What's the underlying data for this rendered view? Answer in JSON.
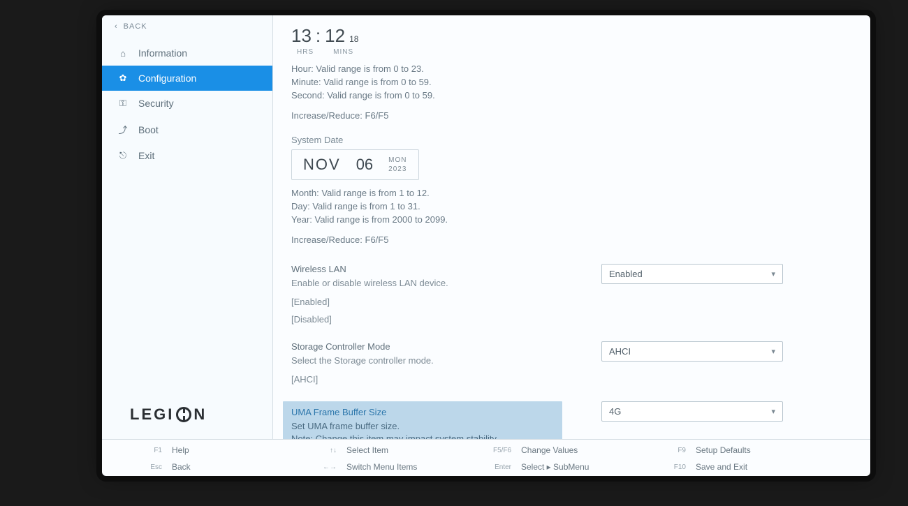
{
  "back_label": "BACK",
  "sidebar": {
    "items": [
      {
        "label": "Information",
        "icon": "⌂"
      },
      {
        "label": "Configuration",
        "icon": "✿"
      },
      {
        "label": "Security",
        "icon": "⚿"
      },
      {
        "label": "Boot",
        "icon": "⤴"
      },
      {
        "label": "Exit",
        "icon": "⎋"
      }
    ],
    "active_index": 1
  },
  "brand": "LEGION",
  "time": {
    "hrs": "13",
    "sep": ":",
    "mins": "12",
    "secs": "18",
    "hrs_label": "HRS",
    "mins_label": "MINS",
    "help": [
      "Hour: Valid range is from 0 to 23.",
      "Minute: Valid range is from 0 to 59.",
      "Second: Valid range is from 0 to 59."
    ],
    "increase_reduce": "Increase/Reduce: F6/F5"
  },
  "date": {
    "section_label": "System Date",
    "month": "NOV",
    "day": "06",
    "dow": "MON",
    "year": "2023",
    "help": [
      "Month: Valid range is from 1 to 12.",
      "Day: Valid range is from 1 to 31.",
      "Year: Valid range is from 2000 to 2099."
    ],
    "increase_reduce": "Increase/Reduce: F6/F5"
  },
  "wireless": {
    "title": "Wireless LAN",
    "desc": "Enable or disable wireless LAN device.",
    "options": [
      "[Enabled]",
      "[Disabled]"
    ],
    "value": "Enabled"
  },
  "storage": {
    "title": "Storage Controller Mode",
    "desc": "Select the Storage controller mode.",
    "options": [
      "[AHCI]"
    ],
    "value": "AHCI"
  },
  "uma": {
    "title": "UMA Frame Buffer Size",
    "desc": "Set UMA frame buffer size.\nNote: Change this item may impact system stability.",
    "value": "4G"
  },
  "footer": [
    {
      "key": "F1",
      "label": "Help"
    },
    {
      "key": "↑↓",
      "label": "Select Item"
    },
    {
      "key": "F5/F6",
      "label": "Change Values"
    },
    {
      "key": "F9",
      "label": "Setup Defaults"
    },
    {
      "key": "Esc",
      "label": "Back"
    },
    {
      "key": "←→",
      "label": "Switch Menu Items"
    },
    {
      "key": "Enter",
      "label": "Select ▸ SubMenu"
    },
    {
      "key": "F10",
      "label": "Save and Exit"
    }
  ]
}
